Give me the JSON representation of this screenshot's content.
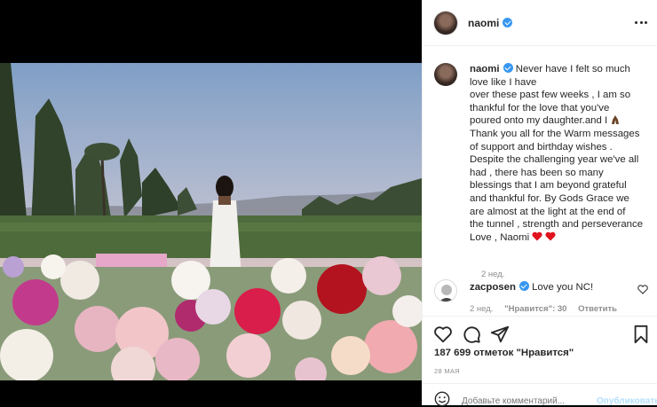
{
  "post": {
    "username": "naomi",
    "caption_lines": [
      "Never have I felt so much",
      "love like I have",
      "over these past few weeks , I am so",
      "thankful for the love that you've",
      "poured onto my daughter.and I",
      "Thank you all for the Warm messages",
      "of support and birthday wishes .",
      "Despite the challenging year we've all",
      "had , there has been so many",
      "blessings that I am beyond grateful",
      "and thankful for. By Gods Grace we",
      "are almost at the light at the end of",
      "the tunnel , strength and perseverance",
      "Love , Naomi"
    ],
    "caption_time": "2 нед.",
    "likes": "187 699 отметок \"Нравится\"",
    "date": "28 МАЯ"
  },
  "reply": {
    "username": "zacposen",
    "text": "Love you NC!",
    "time": "2 нед.",
    "likes": "\"Нравится\": 30",
    "reply_label": "Ответить"
  },
  "comment_box": {
    "placeholder": "Добавьте комментарий...",
    "publish_label": "Опубликовать"
  },
  "icons": {
    "verified": "verified-badge-icon",
    "more": "more-options-icon",
    "like": "heart-icon",
    "comment": "comment-icon",
    "share": "share-icon",
    "save": "bookmark-icon",
    "emoji": "emoji-icon"
  },
  "colors": {
    "verified": "#3897f0",
    "heart_emoji": "#e0141e",
    "link_disabled": "#b2dffc",
    "secondary_text": "#8e8e8e"
  }
}
